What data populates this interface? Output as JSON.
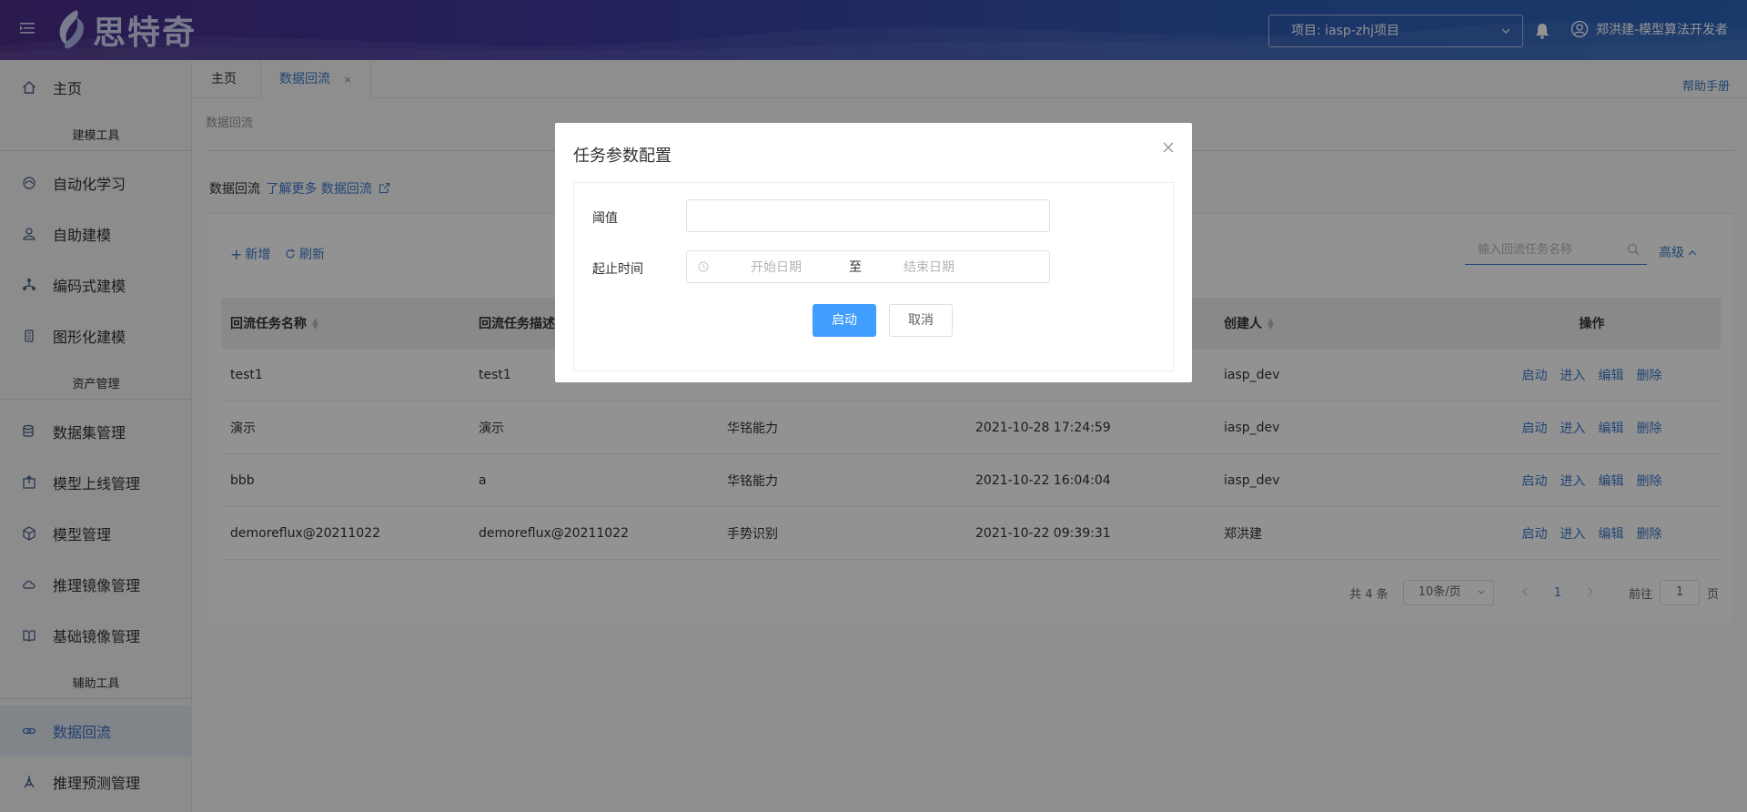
{
  "header": {
    "logo_text": "思特奇",
    "project_select": "项目: iasp-zhj项目",
    "user_name": "郑洪建-模型算法开发者"
  },
  "sidebar": {
    "items": [
      {
        "label": "主页",
        "icon": "home-icon"
      },
      {
        "section": "建模工具"
      },
      {
        "label": "自动化学习",
        "icon": "automl-icon"
      },
      {
        "label": "自助建模",
        "icon": "self-model-icon"
      },
      {
        "label": "编码式建模",
        "icon": "code-model-icon"
      },
      {
        "label": "图形化建模",
        "icon": "graph-model-icon"
      },
      {
        "section": "资产管理"
      },
      {
        "label": "数据集管理",
        "icon": "dataset-icon"
      },
      {
        "label": "模型上线管理",
        "icon": "deploy-icon"
      },
      {
        "label": "模型管理",
        "icon": "model-icon"
      },
      {
        "label": "推理镜像管理",
        "icon": "cloud-icon"
      },
      {
        "label": "基础镜像管理",
        "icon": "book-icon"
      },
      {
        "section": "辅助工具"
      },
      {
        "label": "数据回流",
        "icon": "link-icon",
        "active": true
      },
      {
        "label": "推理预测管理",
        "icon": "predict-icon"
      }
    ]
  },
  "tabs": [
    {
      "label": "主页"
    },
    {
      "label": "数据回流",
      "active": true,
      "close": "×"
    }
  ],
  "help_link": "帮助手册",
  "breadcrumb": "数据回流",
  "intro": {
    "prefix": "数据回流",
    "link": "了解更多 数据回流"
  },
  "toolbar": {
    "add": "新增",
    "refresh": "刷新",
    "search_placeholder": "输入回流任务名称",
    "advanced": "高级"
  },
  "table": {
    "columns": [
      "回流任务名称",
      "回流任务描述",
      "",
      "",
      "创建人",
      "操作"
    ],
    "rows": [
      {
        "name": "test1",
        "desc": "test1",
        "col3": "",
        "time": "",
        "creator": "iasp_dev"
      },
      {
        "name": "演示",
        "desc": "演示",
        "col3": "华铭能力",
        "time": "2021-10-28 17:24:59",
        "creator": "iasp_dev"
      },
      {
        "name": "bbb",
        "desc": "a",
        "col3": "华铭能力",
        "time": "2021-10-22 16:04:04",
        "creator": "iasp_dev"
      },
      {
        "name": "demoreflux@20211022",
        "desc": "demoreflux@20211022",
        "col3": "手势识别",
        "time": "2021-10-22 09:39:31",
        "creator": "郑洪建"
      }
    ],
    "actions": [
      "启动",
      "进入",
      "编辑",
      "删除"
    ]
  },
  "pagination": {
    "total": "共 4 条",
    "page_size": "10条/页",
    "current": "1",
    "goto_prefix": "前往",
    "goto_value": "1",
    "goto_suffix": "页"
  },
  "modal": {
    "title": "任务参数配置",
    "threshold_label": "阈值",
    "threshold_value": "",
    "time_label": "起止时间",
    "start_placeholder": "开始日期",
    "range_separator": "至",
    "end_placeholder": "结束日期",
    "confirm": "启动",
    "cancel": "取消"
  },
  "colors": {
    "primary": "#409eff",
    "link": "#3a78c8"
  }
}
